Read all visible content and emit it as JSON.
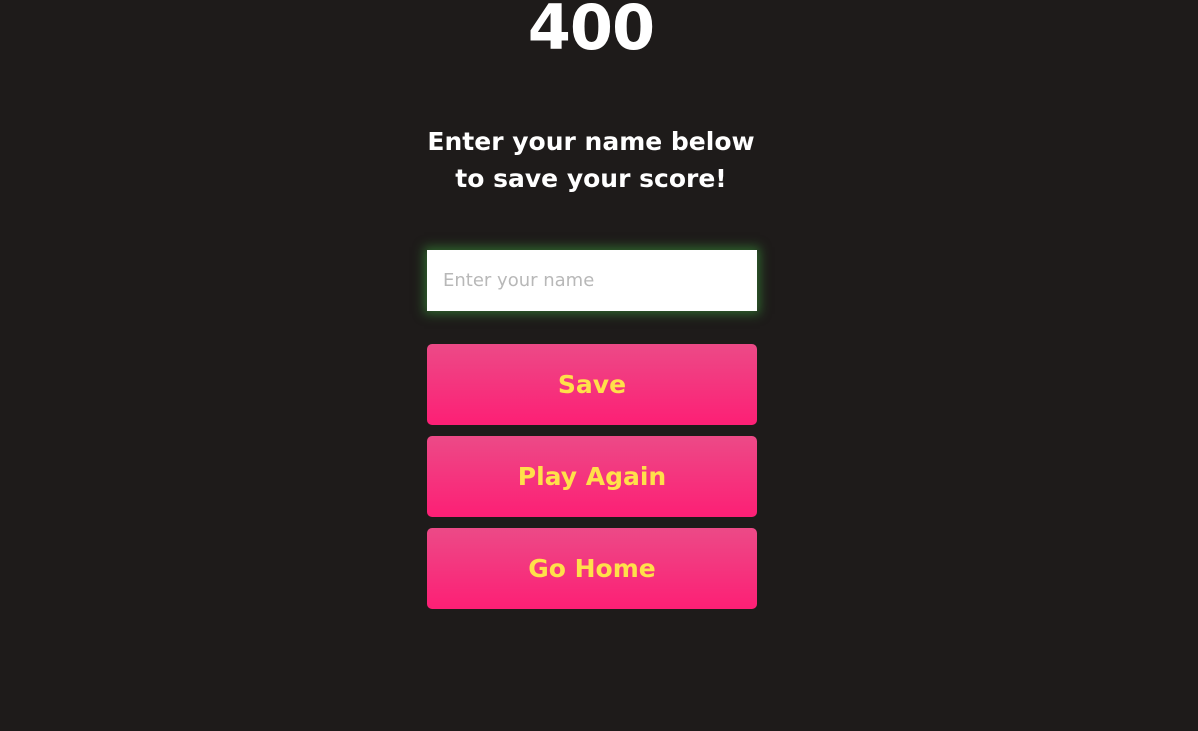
{
  "score": {
    "value": "400"
  },
  "prompt": {
    "line1": "Enter your name below",
    "line2": "to save your score!"
  },
  "name_input": {
    "placeholder": "Enter your name",
    "value": ""
  },
  "buttons": {
    "save_label": "Save",
    "play_again_label": "Play Again",
    "go_home_label": "Go Home"
  },
  "colors": {
    "background": "#1e1b1a",
    "button_top": "#ec4a87",
    "button_bottom": "#fd1f75",
    "button_text": "#ffe04a",
    "input_glow": "#3ca03c"
  }
}
